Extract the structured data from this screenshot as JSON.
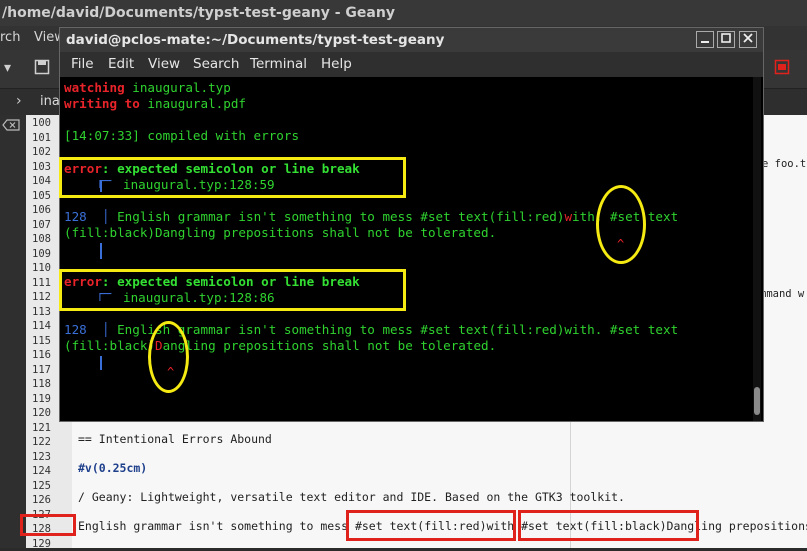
{
  "geany": {
    "window_title": "/home/david/Documents/typst-test-geany - Geany",
    "menu": [
      "rch",
      "View"
    ],
    "tab_label": "ina",
    "line_numbers": [
      "100",
      "101",
      "102",
      "103",
      "104",
      "105",
      "106",
      "107",
      "108",
      "109",
      "110",
      "111",
      "112",
      "113",
      "114",
      "115",
      "116",
      "117",
      "118",
      "119",
      "120",
      "121",
      "122",
      "123",
      "124",
      "125",
      "126",
      "127",
      "128",
      "129"
    ],
    "side_snippets": {
      "foo": "e foo.t",
      "command": "mmand w"
    },
    "code_lines": {
      "l122": "== Intentional Errors Abound",
      "l124": "#v(0.25cm)",
      "l126": "/ Geany: Lightweight, versatile text editor and IDE. Based on the GTK3 toolkit.",
      "l128_a": "English grammar isn't something to mess ",
      "l128_b": "#set text(fill:red)with ",
      "l128_c": "#set text(fill:black)Dang",
      "l128_d": "ling prepositions"
    }
  },
  "terminal": {
    "title": "david@pclos-mate:~/Documents/typst-test-geany",
    "menu": [
      "File",
      "Edit",
      "View",
      "Search",
      "Terminal",
      "Help"
    ],
    "lines": {
      "watching_kw": "watching",
      "watching_file": " inaugural.typ",
      "writing_kw": "writing to",
      "writing_file": " inaugural.pdf",
      "compiled": "[14:07:33] compiled with errors",
      "err1_kw": "error",
      "err1_msg": ": expected semicolon or line break",
      "err1_loc": "inaugural.typ:128:59",
      "err1_num": "128",
      "err1_src1": "English grammar isn't something to mess #set text(fill:red)",
      "err1_src1_hl": "w",
      "err1_src1_rest": "ith. #set text",
      "err1_src2": "(fill:black)Dangling prepositions shall not be tolerated.",
      "err2_kw": "error",
      "err2_msg": ": expected semicolon or line break",
      "err2_loc": "inaugural.typ:128:86",
      "err2_num": "128",
      "err2_src1": "English grammar isn't something to mess #set text(fill:red)with. #set text",
      "err2_src2a": "(fill:black)",
      "err2_src2_hl": "D",
      "err2_src2b": "angling prepositions shall not be tolerated.",
      "caret": "^"
    }
  },
  "colors": {
    "error_red": "#e8232a",
    "term_green": "#2fd22f",
    "annotation_yellow": "#f5ea12",
    "annotation_red": "#e0221c"
  }
}
